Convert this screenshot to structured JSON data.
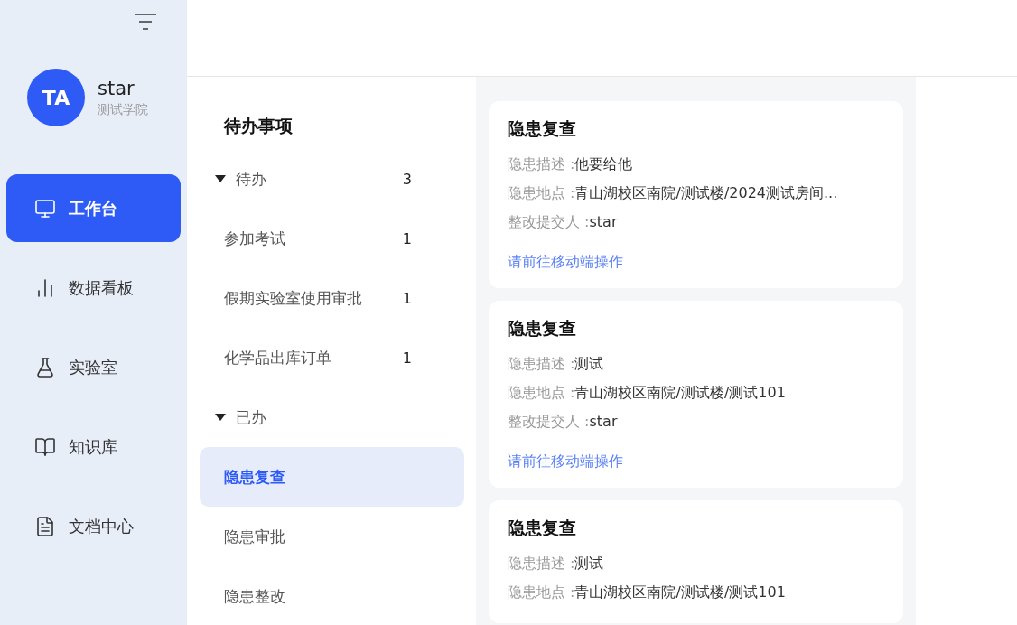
{
  "sidebar": {
    "user": {
      "avatar": "TA",
      "name": "star",
      "org": "测试学院"
    },
    "nav": [
      {
        "label": "工作台",
        "selected": true
      },
      {
        "label": "数据看板",
        "selected": false
      },
      {
        "label": "实验室",
        "selected": false
      },
      {
        "label": "知识库",
        "selected": false
      },
      {
        "label": "文档中心",
        "selected": false
      }
    ]
  },
  "todo": {
    "title": "待办事项",
    "groups": [
      {
        "label": "待办",
        "count": "3",
        "expanded": true,
        "children": [
          {
            "label": "参加考试",
            "count": "1",
            "selected": false
          },
          {
            "label": "假期实验室使用审批",
            "count": "1",
            "selected": false
          },
          {
            "label": "化学品出库订单",
            "count": "1",
            "selected": false
          }
        ]
      },
      {
        "label": "已办",
        "expanded": true,
        "children": [
          {
            "label": "隐患复查",
            "selected": true
          },
          {
            "label": "隐患审批",
            "selected": false
          },
          {
            "label": "隐患整改",
            "selected": false
          }
        ]
      }
    ]
  },
  "cards": [
    {
      "title": "隐患复查",
      "fields": [
        {
          "label": "隐患描述 :",
          "value": "他要给他"
        },
        {
          "label": "隐患地点 :",
          "value": "青山湖校区南院/测试楼/2024测试房间..."
        },
        {
          "label": "整改提交人 :",
          "value": "star"
        }
      ],
      "link": "请前往移动端操作"
    },
    {
      "title": "隐患复查",
      "fields": [
        {
          "label": "隐患描述 :",
          "value": "测试"
        },
        {
          "label": "隐患地点 :",
          "value": "青山湖校区南院/测试楼/测试101"
        },
        {
          "label": "整改提交人 :",
          "value": "star"
        }
      ],
      "link": "请前往移动端操作"
    },
    {
      "title": "隐患复查",
      "fields": [
        {
          "label": "隐患描述 :",
          "value": "测试"
        },
        {
          "label": "隐患地点 :",
          "value": "青山湖校区南院/测试楼/测试101"
        }
      ]
    }
  ]
}
